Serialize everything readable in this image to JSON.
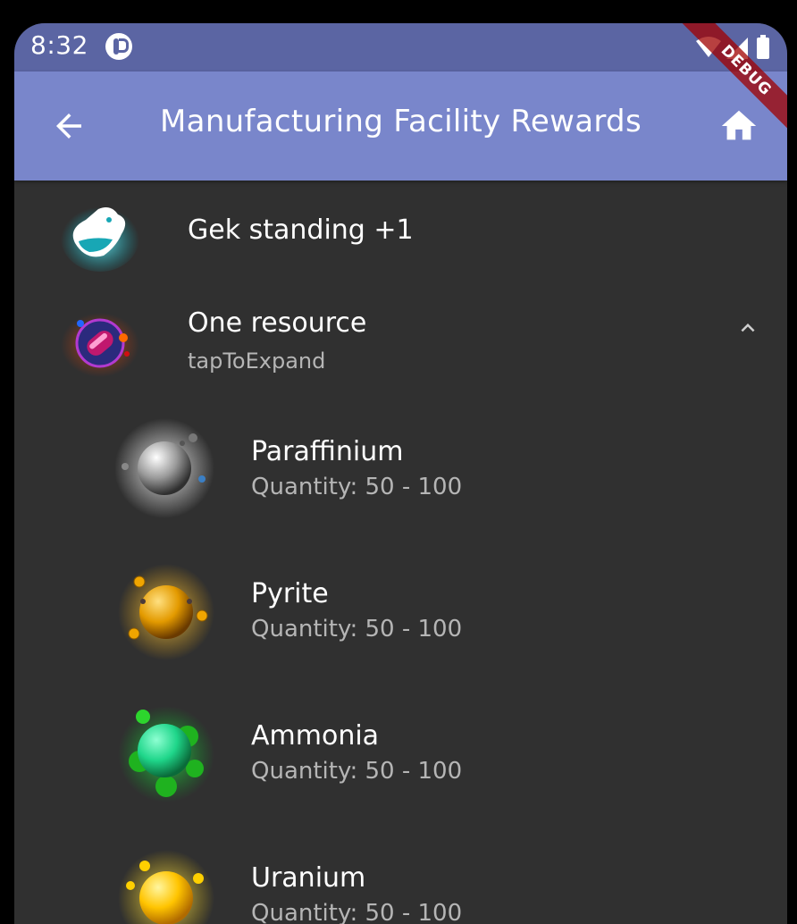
{
  "status_bar": {
    "time": "8:32",
    "icons": [
      "app-notification-icon",
      "wifi-icon",
      "signal-icon",
      "battery-icon"
    ]
  },
  "debug_banner": "DEBUG",
  "app_bar": {
    "title": "Manufacturing Facility Rewards",
    "back_icon": "arrow-back-icon",
    "home_icon": "home-icon",
    "color": "#7986cb"
  },
  "rewards": {
    "gek": {
      "title": "Gek standing +1",
      "icon": "gek-race-icon"
    },
    "resource": {
      "title": "One resource",
      "subtitle": "tapToExpand",
      "icon": "resource-capsule-icon",
      "expand_icon": "chevron-up-icon",
      "items": [
        {
          "name": "Paraffinium",
          "quantity": "Quantity: 50 - 100",
          "icon": "paraffinium-icon",
          "color": "#c8c8c8"
        },
        {
          "name": "Pyrite",
          "quantity": "Quantity: 50 - 100",
          "icon": "pyrite-icon",
          "color": "#f5a800"
        },
        {
          "name": "Ammonia",
          "quantity": "Quantity: 50 - 100",
          "icon": "ammonia-icon",
          "color": "#1fd68a"
        },
        {
          "name": "Uranium",
          "quantity": "Quantity: 50 - 100",
          "icon": "uranium-icon",
          "color": "#ffd000"
        }
      ]
    }
  }
}
